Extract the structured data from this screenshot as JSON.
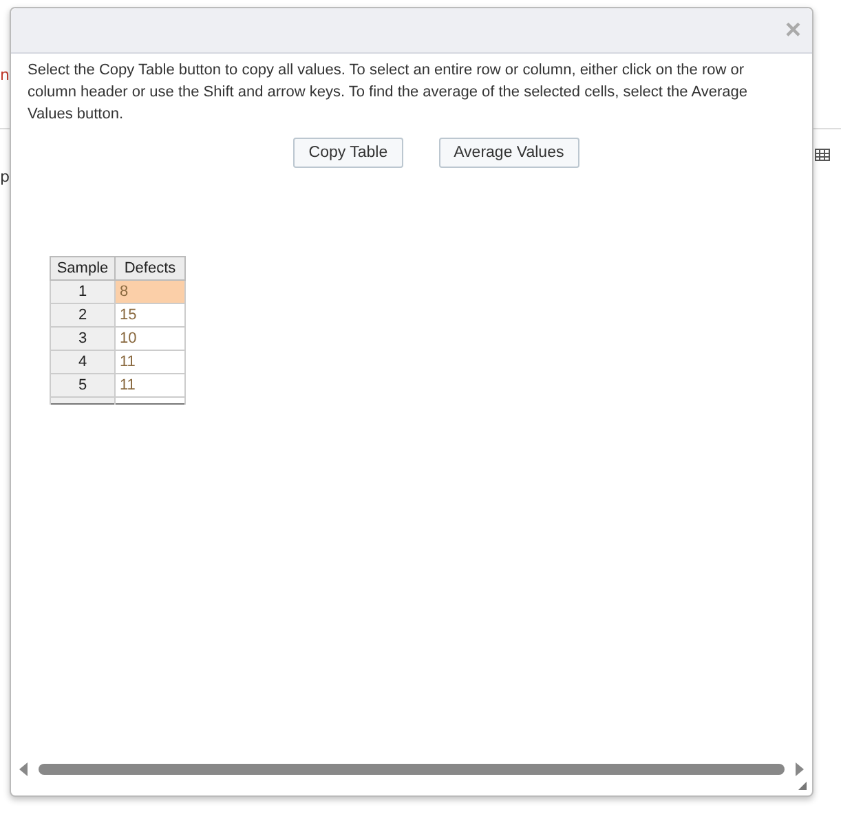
{
  "background": {
    "fragments": [
      "n",
      "p"
    ]
  },
  "dialog": {
    "instructions": "Select the Copy Table button to copy all values. To select an entire row or column, either click on the row or column header or use the Shift and arrow keys. To find the average of the selected cells, select the Average Values button.",
    "close_icon": "×",
    "buttons": [
      "Copy Table",
      "Average Values"
    ],
    "table": {
      "columns": [
        "Sample",
        "Defects"
      ],
      "rows": [
        {
          "sample": "1",
          "defects": "8",
          "selected": true
        },
        {
          "sample": "2",
          "defects": "15",
          "selected": false
        },
        {
          "sample": "3",
          "defects": "10",
          "selected": false
        },
        {
          "sample": "4",
          "defects": "11",
          "selected": false
        },
        {
          "sample": "5",
          "defects": "11",
          "selected": false
        }
      ]
    }
  }
}
